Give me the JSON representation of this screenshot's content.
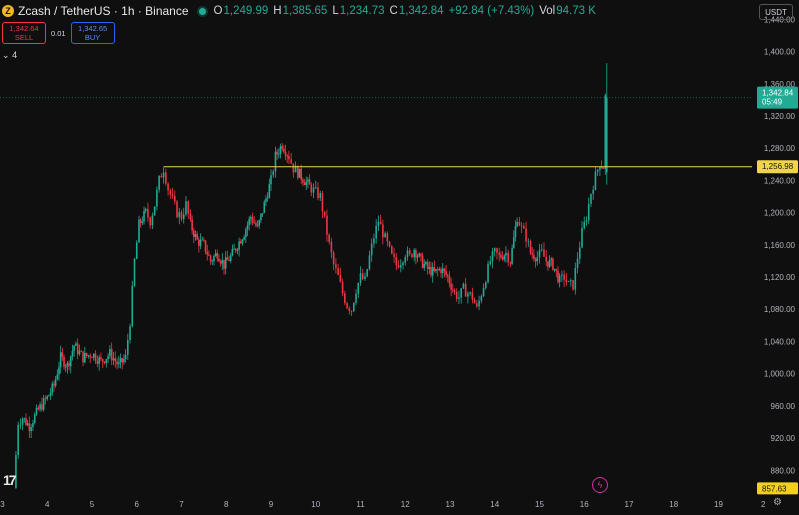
{
  "header": {
    "symbol": "Zcash / TetherUS · 1h · Binance",
    "coin_icon": "Z",
    "open_key": "O",
    "open": "1,249.99",
    "high_key": "H",
    "high": "1,385.65",
    "low_key": "L",
    "low": "1,234.73",
    "close_key": "C",
    "close": "1,342.84",
    "change": "+92.84 (+7.43%)",
    "vol_key": "Vol",
    "vol": "94.73 K"
  },
  "trade": {
    "sell_price": "1,342.64",
    "sell_label": "SELL",
    "spread": "0.01",
    "buy_price": "1,342.65",
    "buy_label": "BUY"
  },
  "indicator_toggle": "4",
  "currency": "USDT",
  "colors": {
    "up": "#22ab94",
    "down": "#f23645",
    "hline": "#f0d54a",
    "grid_text": "#b2b5be"
  },
  "chart_data": {
    "type": "candlestick",
    "y_ticks": [
      880,
      920,
      960,
      1000,
      1040,
      1080,
      1120,
      1160,
      1200,
      1240,
      1280,
      1320,
      1360,
      1400,
      1440
    ],
    "y_tick_labels": [
      "880.00",
      "920.00",
      "960.00",
      "1,000.00",
      "1,040.00",
      "1,080.00",
      "1,120.00",
      "1,160.00",
      "1,200.00",
      "1,240.00",
      "1,280.00",
      "1,320.00",
      "1,360.00",
      "1,400.00",
      "1,440.00"
    ],
    "x_ticks": [
      3,
      4,
      5,
      6,
      7,
      8,
      9,
      10,
      11,
      12,
      13,
      14,
      15,
      16,
      17,
      18,
      19,
      2
    ],
    "ylim": [
      863,
      1464
    ],
    "hline": {
      "value": 1256.98,
      "label": "1,256.98"
    },
    "last_price": {
      "value": 1342.84,
      "label": "1,342.84",
      "countdown": "05:49"
    },
    "low_marker": {
      "value": 857.63,
      "label": "857.63"
    },
    "close_path": [
      [
        3.25,
        858
      ],
      [
        3.35,
        940
      ],
      [
        3.45,
        945
      ],
      [
        3.6,
        935
      ],
      [
        3.8,
        955
      ],
      [
        4.0,
        970
      ],
      [
        4.15,
        985
      ],
      [
        4.3,
        1020
      ],
      [
        4.45,
        1010
      ],
      [
        4.6,
        1035
      ],
      [
        4.8,
        1020
      ],
      [
        5.0,
        1025
      ],
      [
        5.2,
        1015
      ],
      [
        5.4,
        1025
      ],
      [
        5.6,
        1010
      ],
      [
        5.75,
        1020
      ],
      [
        5.85,
        1065
      ],
      [
        5.95,
        1140
      ],
      [
        6.05,
        1185
      ],
      [
        6.2,
        1200
      ],
      [
        6.3,
        1190
      ],
      [
        6.4,
        1210
      ],
      [
        6.5,
        1240
      ],
      [
        6.6,
        1255
      ],
      [
        6.7,
        1230
      ],
      [
        6.8,
        1215
      ],
      [
        6.9,
        1200
      ],
      [
        7.0,
        1195
      ],
      [
        7.1,
        1210
      ],
      [
        7.2,
        1185
      ],
      [
        7.35,
        1165
      ],
      [
        7.5,
        1160
      ],
      [
        7.65,
        1140
      ],
      [
        7.8,
        1150
      ],
      [
        7.95,
        1135
      ],
      [
        8.1,
        1145
      ],
      [
        8.25,
        1160
      ],
      [
        8.4,
        1175
      ],
      [
        8.55,
        1195
      ],
      [
        8.7,
        1180
      ],
      [
        8.85,
        1210
      ],
      [
        9.0,
        1240
      ],
      [
        9.1,
        1270
      ],
      [
        9.25,
        1285
      ],
      [
        9.4,
        1270
      ],
      [
        9.5,
        1255
      ],
      [
        9.6,
        1250
      ],
      [
        9.75,
        1240
      ],
      [
        9.9,
        1230
      ],
      [
        10.0,
        1225
      ],
      [
        10.1,
        1220
      ],
      [
        10.2,
        1190
      ],
      [
        10.3,
        1160
      ],
      [
        10.4,
        1135
      ],
      [
        10.5,
        1120
      ],
      [
        10.6,
        1100
      ],
      [
        10.7,
        1085
      ],
      [
        10.8,
        1080
      ],
      [
        10.9,
        1105
      ],
      [
        11.0,
        1120
      ],
      [
        11.1,
        1115
      ],
      [
        11.2,
        1145
      ],
      [
        11.3,
        1170
      ],
      [
        11.4,
        1190
      ],
      [
        11.5,
        1175
      ],
      [
        11.6,
        1160
      ],
      [
        11.7,
        1145
      ],
      [
        11.8,
        1135
      ],
      [
        11.9,
        1140
      ],
      [
        12.0,
        1150
      ],
      [
        12.1,
        1145
      ],
      [
        12.2,
        1155
      ],
      [
        12.35,
        1140
      ],
      [
        12.5,
        1130
      ],
      [
        12.65,
        1125
      ],
      [
        12.8,
        1130
      ],
      [
        12.95,
        1120
      ],
      [
        13.1,
        1100
      ],
      [
        13.2,
        1095
      ],
      [
        13.3,
        1105
      ],
      [
        13.4,
        1100
      ],
      [
        13.5,
        1095
      ],
      [
        13.6,
        1080
      ],
      [
        13.7,
        1100
      ],
      [
        13.8,
        1120
      ],
      [
        13.9,
        1140
      ],
      [
        14.0,
        1150
      ],
      [
        14.1,
        1145
      ],
      [
        14.25,
        1150
      ],
      [
        14.35,
        1140
      ],
      [
        14.5,
        1195
      ],
      [
        14.6,
        1180
      ],
      [
        14.7,
        1170
      ],
      [
        14.8,
        1150
      ],
      [
        14.95,
        1145
      ],
      [
        15.05,
        1150
      ],
      [
        15.15,
        1140
      ],
      [
        15.3,
        1135
      ],
      [
        15.45,
        1115
      ],
      [
        15.55,
        1120
      ],
      [
        15.65,
        1110
      ],
      [
        15.75,
        1110
      ],
      [
        15.85,
        1145
      ],
      [
        15.95,
        1175
      ],
      [
        16.05,
        1195
      ],
      [
        16.15,
        1225
      ],
      [
        16.25,
        1245
      ],
      [
        16.35,
        1262
      ],
      [
        16.42,
        1257
      ],
      [
        16.47,
        1343
      ]
    ]
  }
}
